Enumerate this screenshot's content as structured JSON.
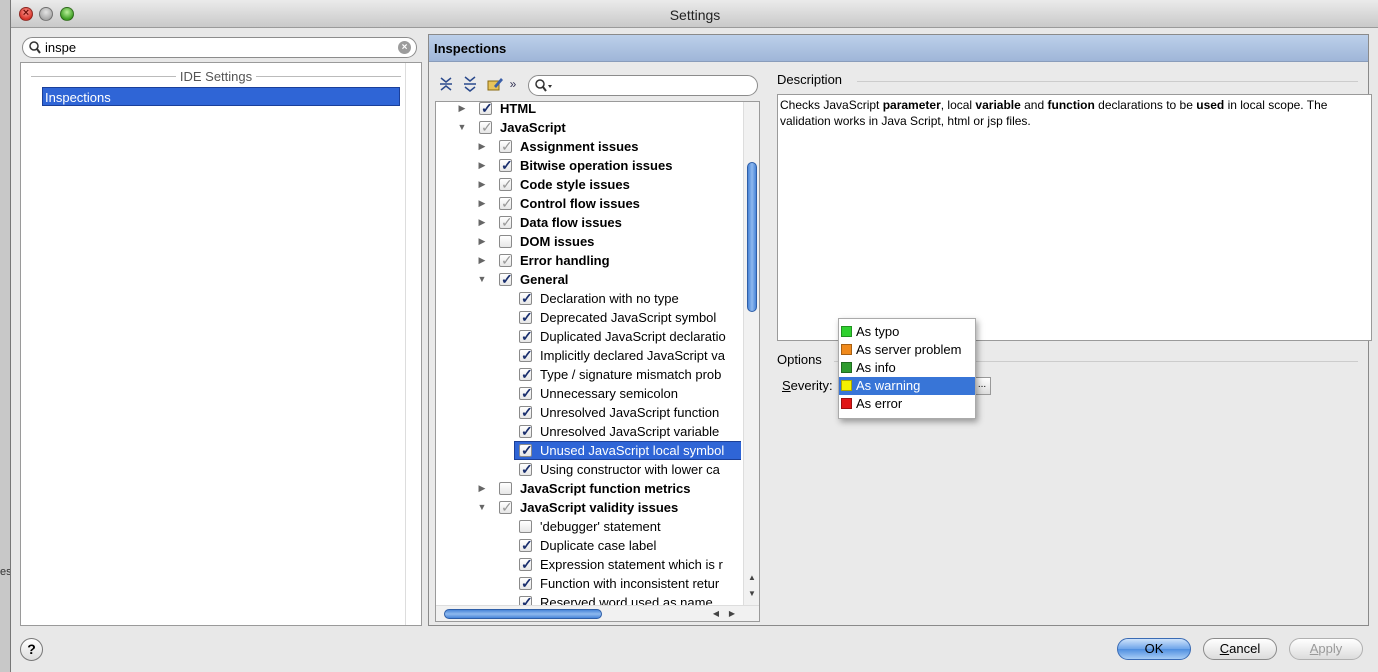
{
  "window": {
    "title": "Settings"
  },
  "background": {
    "fragment": "es"
  },
  "search": {
    "value": "inspe"
  },
  "left_panel": {
    "section_header": "IDE Settings",
    "selected_item": "Inspections"
  },
  "right_panel": {
    "header": "Inspections",
    "tree_search": {
      "value": ""
    },
    "tree": [
      {
        "label": "HTML",
        "bold": true,
        "arrow": "right",
        "check": "on",
        "level": 0
      },
      {
        "label": "JavaScript",
        "bold": true,
        "arrow": "down",
        "check": "grey",
        "level": 0
      },
      {
        "label": "Assignment issues",
        "bold": true,
        "arrow": "right",
        "check": "grey",
        "level": 1
      },
      {
        "label": "Bitwise operation issues",
        "bold": true,
        "arrow": "right",
        "check": "on",
        "level": 1
      },
      {
        "label": "Code style issues",
        "bold": true,
        "arrow": "right",
        "check": "grey",
        "level": 1
      },
      {
        "label": "Control flow issues",
        "bold": true,
        "arrow": "right",
        "check": "grey",
        "level": 1
      },
      {
        "label": "Data flow issues",
        "bold": true,
        "arrow": "right",
        "check": "grey",
        "level": 1
      },
      {
        "label": "DOM issues",
        "bold": true,
        "arrow": "right",
        "check": "off",
        "level": 1
      },
      {
        "label": "Error handling",
        "bold": true,
        "arrow": "right",
        "check": "grey",
        "level": 1
      },
      {
        "label": "General",
        "bold": true,
        "arrow": "down",
        "check": "on",
        "level": 1
      },
      {
        "label": "Declaration with no type",
        "bold": false,
        "arrow": "",
        "check": "on",
        "level": 2
      },
      {
        "label": "Deprecated JavaScript symbol",
        "bold": false,
        "arrow": "",
        "check": "on",
        "level": 2
      },
      {
        "label": "Duplicated JavaScript declaratio",
        "bold": false,
        "arrow": "",
        "check": "on",
        "level": 2
      },
      {
        "label": "Implicitly declared JavaScript va",
        "bold": false,
        "arrow": "",
        "check": "on",
        "level": 2
      },
      {
        "label": "Type / signature mismatch prob",
        "bold": false,
        "arrow": "",
        "check": "on",
        "level": 2
      },
      {
        "label": "Unnecessary semicolon",
        "bold": false,
        "arrow": "",
        "check": "on",
        "level": 2
      },
      {
        "label": "Unresolved JavaScript function",
        "bold": false,
        "arrow": "",
        "check": "on",
        "level": 2
      },
      {
        "label": "Unresolved JavaScript variable",
        "bold": false,
        "arrow": "",
        "check": "on",
        "level": 2
      },
      {
        "label": "Unused JavaScript local symbol",
        "bold": false,
        "arrow": "",
        "check": "on",
        "level": 2,
        "selected": true
      },
      {
        "label": "Using constructor with lower ca",
        "bold": false,
        "arrow": "",
        "check": "on",
        "level": 2
      },
      {
        "label": "JavaScript function metrics",
        "bold": true,
        "arrow": "right",
        "check": "off",
        "level": 1
      },
      {
        "label": "JavaScript validity issues",
        "bold": true,
        "arrow": "down",
        "check": "grey",
        "level": 1
      },
      {
        "label": "'debugger' statement",
        "bold": false,
        "arrow": "",
        "check": "off",
        "level": 2
      },
      {
        "label": "Duplicate case label",
        "bold": false,
        "arrow": "",
        "check": "on",
        "level": 2
      },
      {
        "label": "Expression statement which is r",
        "bold": false,
        "arrow": "",
        "check": "on",
        "level": 2
      },
      {
        "label": "Function with inconsistent retur",
        "bold": false,
        "arrow": "",
        "check": "on",
        "level": 2
      },
      {
        "label": "Reserved word used as name",
        "bold": false,
        "arrow": "",
        "check": "on",
        "level": 2
      }
    ],
    "description": {
      "label": "Description",
      "parts": [
        {
          "t": "Checks JavaScript ",
          "b": false
        },
        {
          "t": "parameter",
          "b": true
        },
        {
          "t": ", local ",
          "b": false
        },
        {
          "t": "variable",
          "b": true
        },
        {
          "t": " and ",
          "b": false
        },
        {
          "t": "function",
          "b": true
        },
        {
          "t": " declarations to be ",
          "b": false
        },
        {
          "t": "used",
          "b": true
        },
        {
          "t": " in local scope. The validation works in Java Script, html or jsp files.",
          "b": false
        }
      ]
    },
    "options": {
      "label": "Options",
      "severity_label_underlined": "S",
      "severity_label_rest": "everity:",
      "more_button": "...",
      "severity_options": [
        {
          "label": "As typo",
          "color": "#2fd12f",
          "selected": false
        },
        {
          "label": "As server problem",
          "color": "#f08a1c",
          "selected": false
        },
        {
          "label": "As info",
          "color": "#2e9b2e",
          "selected": false
        },
        {
          "label": "As warning",
          "color": "#f4f000",
          "selected": true
        },
        {
          "label": "As error",
          "color": "#e01616",
          "selected": false
        }
      ]
    }
  },
  "footer": {
    "help": "?",
    "ok": "OK",
    "cancel_u": "C",
    "cancel_rest": "ancel",
    "apply_u": "A",
    "apply_rest": "pply"
  }
}
